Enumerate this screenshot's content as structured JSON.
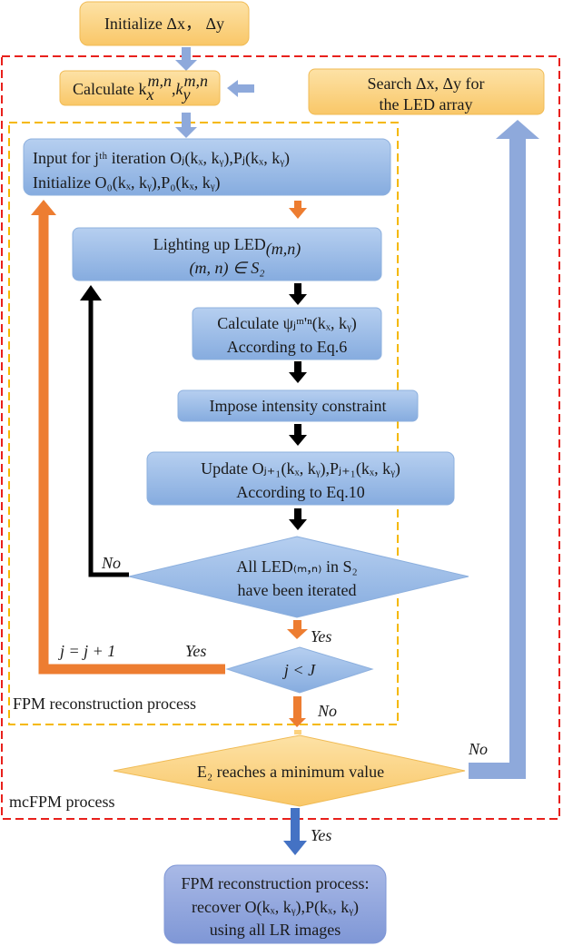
{
  "nodes": {
    "init": {
      "line1": "Initialize Δx，  Δy"
    },
    "calc_k": {
      "line1": "Calculate k",
      "sup": "m,n",
      "sub_x": "x",
      "sub_y": "y"
    },
    "search": {
      "line1": "Search Δx, Δy for",
      "line2": "the LED array"
    },
    "input": {
      "line1_a": "Input for j",
      "line1_sup": "th",
      "line1_b": " iteration   O",
      "line1_c": "(k",
      "line1_d": ", k",
      "line1_e": "),P",
      "line2": "Initialize O₀(kₓ, kᵧ),P₀(kₓ, kᵧ)",
      "line1_full": "Input for jᵗʰ iteration   Oⱼ(kₓ, kᵧ),Pⱼ(kₓ, kᵧ)"
    },
    "lighting": {
      "line1": "Lighting up LED",
      "line1_sub": "(m,n)",
      "line2": "(m, n) ∈ S₂"
    },
    "calc_psi": {
      "line1": "Calculate ψⱼᵐ'ⁿ(kₓ, kᵧ)",
      "line2": "According to Eq.6"
    },
    "impose": {
      "line1": "Impose intensity constraint"
    },
    "update": {
      "line1": "Update Oⱼ₊₁(kₓ, kᵧ),Pⱼ₊₁(kₓ, kᵧ)",
      "line2": "According to Eq.10"
    },
    "all_led": {
      "line1": "All LED₍ₘ,ₙ₎ in S₂",
      "line2": "have been iterated"
    },
    "j_less": {
      "line1": "j < J"
    },
    "e2": {
      "line1": "E₂ reaches a minimum value"
    },
    "final": {
      "line1": "FPM reconstruction  process:",
      "line2": "recover O(kₓ, kᵧ),P(kₓ, kᵧ)",
      "line3": "using all LR images"
    }
  },
  "labels": {
    "no_inner": "No",
    "yes_inner": "Yes",
    "j_increment": "j = j + 1",
    "yes_loop": "Yes",
    "no_j": "No",
    "no_e2": "No",
    "yes_final": "Yes",
    "fpm_region": "FPM reconstruction process",
    "mcfpm_region": "mcFPM process"
  },
  "colors": {
    "orange_box": "#fcd27e",
    "blue_box": "#9dbde6",
    "final_box": "#8fa6dd",
    "red_dash": "#e8201c",
    "yellow_dash": "#f5b800",
    "orange_arrow": "#ed7d31",
    "blue_arrow": "#8ea9db",
    "dark_blue_arrow": "#4472c4"
  }
}
